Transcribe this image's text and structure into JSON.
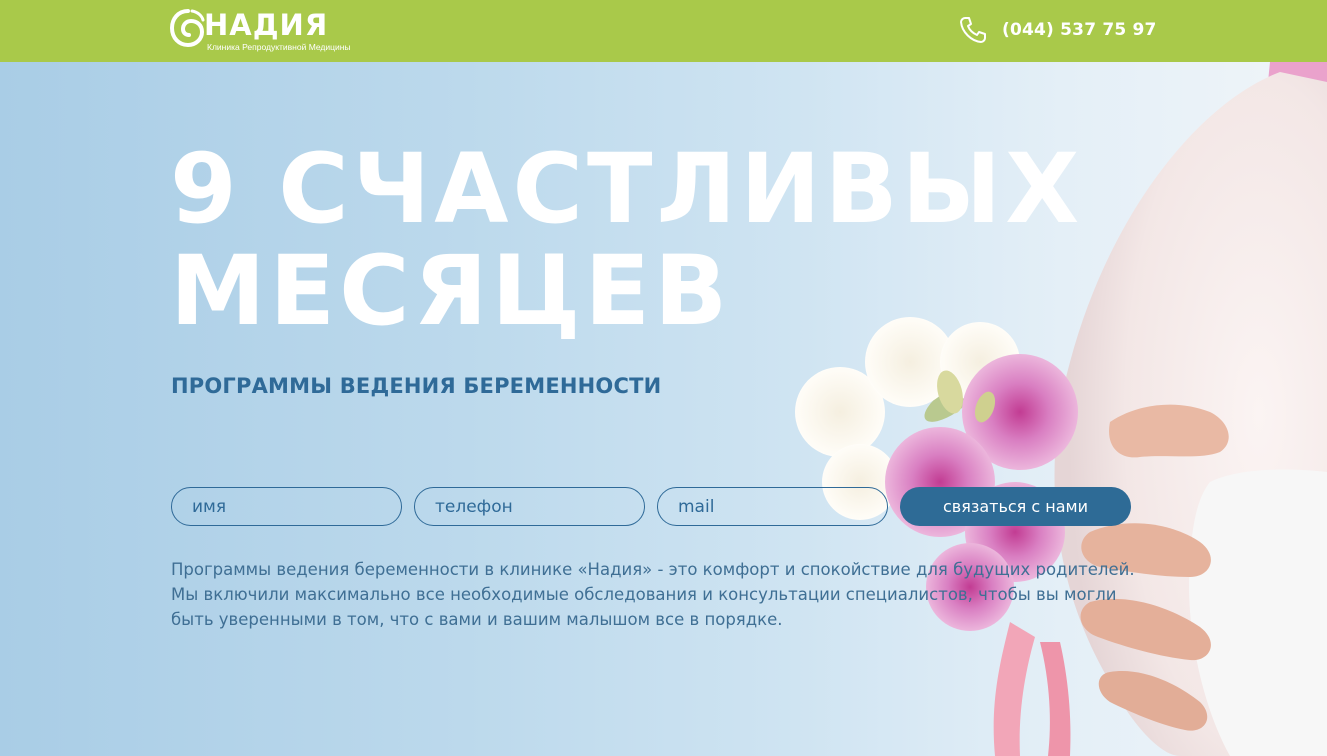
{
  "header": {
    "logo_name": "НАДИЯ",
    "logo_tagline": "Клиника Репродуктивной Медицины",
    "phone": "(044) 537 75 97",
    "colors": {
      "bar": "#a9c94a",
      "text": "#ffffff"
    },
    "icons": {
      "logo": "nadiya-logo-icon",
      "phone": "phone-icon"
    }
  },
  "hero": {
    "headline_line1": "9 СЧАСТЛИВЫХ",
    "headline_line2": "МЕСЯЦЕВ",
    "subtitle": "ПРОГРАММЫ ВЕДЕНИЯ БЕРЕМЕННОСТИ"
  },
  "form": {
    "name_placeholder": "имя",
    "phone_placeholder": "телефон",
    "mail_placeholder": "mail",
    "submit_label": "связаться с нами",
    "accent": "#2e6b96"
  },
  "description": {
    "line1": "Программы ведения беременности в клинике «Надия» - это комфорт и спокойствие для будущих родителей.",
    "line2": "Мы включили максимально все необходимые обследования и консультации специалистов, чтобы вы могли",
    "line3": "быть уверенными в том, что с вами и вашим малышом все в порядке."
  }
}
